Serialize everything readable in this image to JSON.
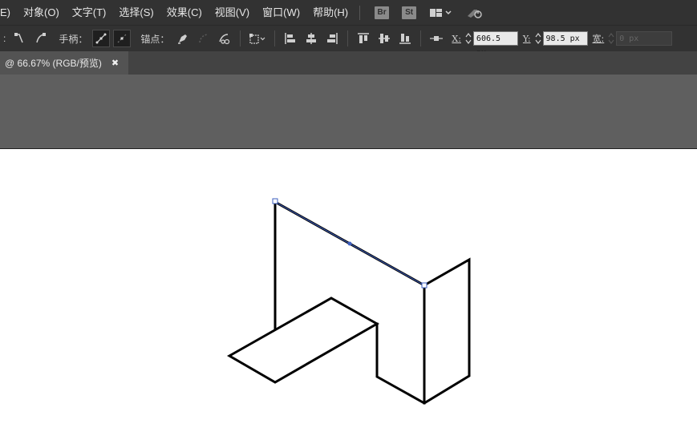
{
  "menu": {
    "items": [
      {
        "name": "menu-edit-fragment",
        "label": "E)"
      },
      {
        "name": "menu-object",
        "label": "对象(O)"
      },
      {
        "name": "menu-type",
        "label": "文字(T)"
      },
      {
        "name": "menu-select",
        "label": "选择(S)"
      },
      {
        "name": "menu-effect",
        "label": "效果(C)"
      },
      {
        "name": "menu-view",
        "label": "视图(V)"
      },
      {
        "name": "menu-window",
        "label": "窗口(W)"
      },
      {
        "name": "menu-help",
        "label": "帮助(H)"
      }
    ],
    "bridge_badge": "Br",
    "stock_badge": "St"
  },
  "toolbar": {
    "colon": ":",
    "handles_label": "手柄：",
    "anchors_label": "锚点：",
    "x_label": "X:",
    "x_value": "606.5 px",
    "y_label": "Y:",
    "y_value": "98.5 px",
    "width_label": "宽:",
    "width_value": "0 px"
  },
  "document": {
    "tab_label": "@ 66.67% (RGB/预览)",
    "close_glyph": "✖"
  },
  "colors": {
    "ui_dark": "#323232",
    "tab_bar": "#434343",
    "pasteboard": "#5f5f5f",
    "artboard": "#ffffff",
    "stroke": "#000000",
    "selection": "#3d5fbf"
  }
}
